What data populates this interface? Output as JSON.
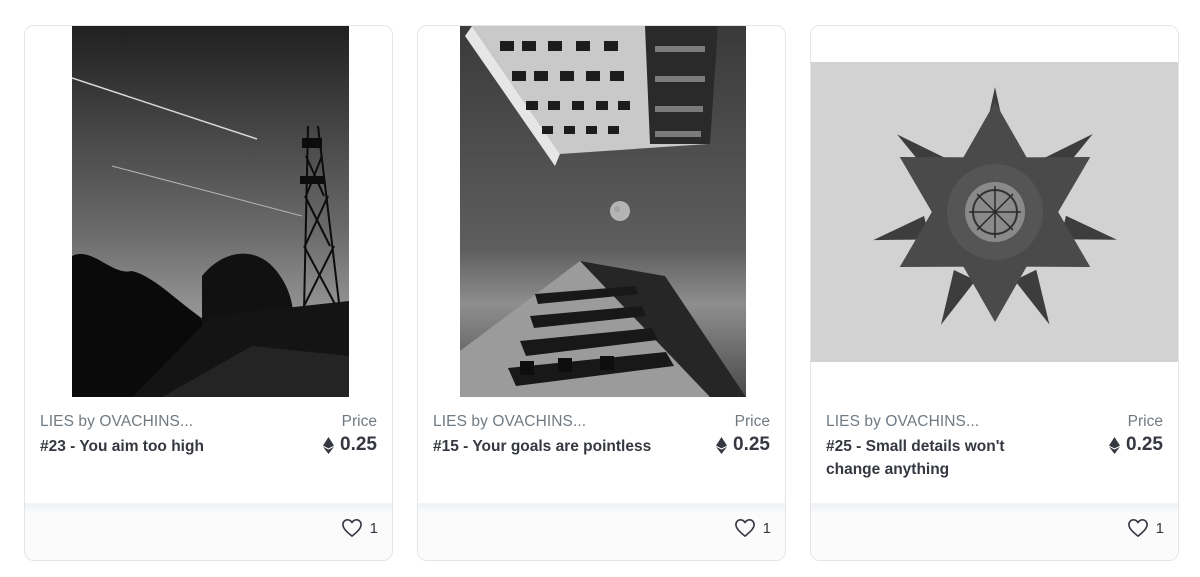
{
  "cards": [
    {
      "collection": "LIES by OVACHINS...",
      "title": "#23 - You aim too high",
      "price_label": "Price",
      "price": "0.25",
      "currency_icon": "ethereum-icon",
      "favorites": "1",
      "favorite_icon": "heart-icon"
    },
    {
      "collection": "LIES by OVACHINS...",
      "title": "#15 - Your goals are pointless",
      "price_label": "Price",
      "price": "0.25",
      "currency_icon": "ethereum-icon",
      "favorites": "1",
      "favorite_icon": "heart-icon"
    },
    {
      "collection": "LIES by OVACHINS...",
      "title": "#25 - Small details won't change anything",
      "price_label": "Price",
      "price": "0.25",
      "currency_icon": "ethereum-icon",
      "favorites": "1",
      "favorite_icon": "heart-icon"
    }
  ]
}
